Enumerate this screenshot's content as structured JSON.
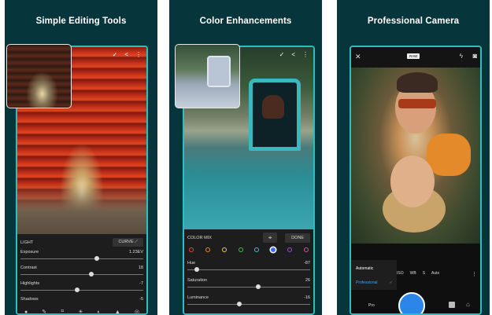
{
  "panels": [
    {
      "title": "Simple Editing Tools",
      "controls": {
        "section": "LIGHT",
        "curve_button": "CURVE",
        "sliders": [
          {
            "label": "Exposure",
            "value": "1.23EV",
            "level": 0.62
          },
          {
            "label": "Contrast",
            "value": "18",
            "level": 0.58
          },
          {
            "label": "Highlights",
            "value": "-7",
            "level": 0.46
          },
          {
            "label": "Shadows",
            "value": "-5",
            "level": 0.48
          }
        ],
        "bottom_icons": [
          "presets-icon",
          "brush-icon",
          "crop-icon",
          "adjust-icon",
          "effects-icon",
          "detail-icon",
          "optics-icon"
        ]
      }
    },
    {
      "title": "Color Enhancements",
      "controls": {
        "section": "COLOR MIX",
        "done_button": "DONE",
        "colors": [
          "#e5463a",
          "#f08a2a",
          "#e6d435",
          "#3fc24a",
          "#35c7c7",
          "#3a6df0",
          "#a24ae0",
          "#e04ab3"
        ],
        "selected_color_index": 5,
        "sliders": [
          {
            "label": "Hue",
            "value": "-87",
            "level": 0.08
          },
          {
            "label": "Saturation",
            "value": "26",
            "level": 0.58
          },
          {
            "label": "Luminance",
            "value": "-16",
            "level": 0.42
          }
        ]
      }
    },
    {
      "title": "Professional Camera",
      "camera": {
        "mode_badge": "RAW",
        "menu": {
          "automatic": "Automatic",
          "professional": "Professional"
        },
        "settings": [
          "ISO",
          "WB",
          "S",
          "Auto"
        ],
        "pro_label": "Pro"
      }
    }
  ]
}
